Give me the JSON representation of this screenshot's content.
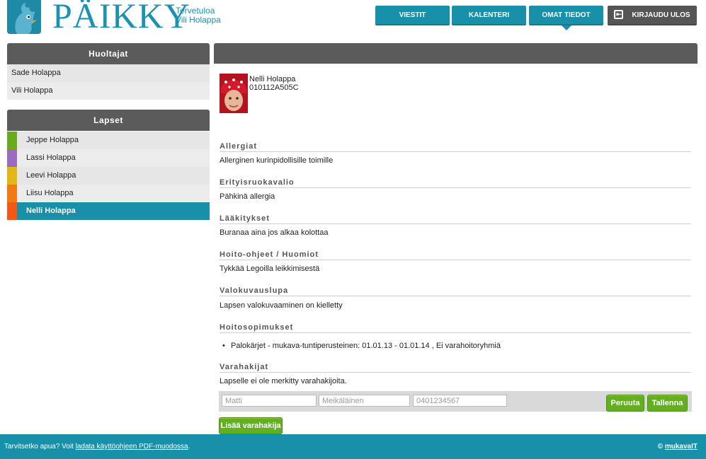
{
  "header": {
    "logo_text": "PÄIKKY",
    "welcome_line1": "Tervetuloa",
    "welcome_line2": "Vili Holappa",
    "nav": {
      "messages": "VIESTIT",
      "calendar": "KALENTERI",
      "my_info": "OMAT TIEDOT",
      "logout": "KIRJAUDU ULOS"
    }
  },
  "sidebar": {
    "guardians_title": "Huoltajat",
    "guardians": [
      "Sade Holappa",
      "Vili Holappa"
    ],
    "children_title": "Lapset",
    "children": [
      {
        "name": "Jeppe Holappa",
        "color": "#6aaa1f"
      },
      {
        "name": "Lassi Holappa",
        "color": "#9b6bc0"
      },
      {
        "name": "Leevi Holappa",
        "color": "#e0b81a"
      },
      {
        "name": "Liisu Holappa",
        "color": "#f07a14"
      },
      {
        "name": "Nelli Holappa",
        "color": "#f05a14",
        "selected": true
      }
    ]
  },
  "child": {
    "name": "Nelli Holappa",
    "id": "010112A505C"
  },
  "sections": {
    "allergies_title": "Allergiat",
    "allergies_text": "Allerginen kurinpidollisille toimille",
    "diet_title": "Erityisruokavalio",
    "diet_text": "Pähkinä allergia",
    "meds_title": "Lääkitykset",
    "meds_text": "Buranaa aina jos alkaa kolottaa",
    "care_title": "Hoito-ohjeet / Huomiot",
    "care_text": "Tykkää Legoilla leikkimisestä",
    "photo_title": "Valokuvauslupa",
    "photo_text": "Lapsen valokuvaaminen on kielletty",
    "contracts_title": "Hoitosopimukset",
    "contracts_item": "Palokärjet - mukava-tuntiperusteinen: 01.01.13 - 01.01.14 , Ei varahoitoryhmiä",
    "backup_title": "Varahakijat",
    "backup_text": "Lapselle ei ole merkitty varahakijoita."
  },
  "form": {
    "first_name_placeholder": "Matti",
    "last_name_placeholder": "Meikäläinen",
    "phone_placeholder": "0401234567",
    "cancel_label": "Peruuta",
    "save_label": "Tallenna",
    "add_label": "Lisää varahakija"
  },
  "footer": {
    "help_prefix": "Tarvitsetko apua? Voit ",
    "help_link": "ladata käyttöohjeen PDF-muodossa",
    "help_suffix": ".",
    "copyright_symbol": "©",
    "copyright_link": "mukavaIT"
  },
  "colors": {
    "primary": "#1990a9",
    "header_gray": "#5b5b5b",
    "green_button": "#62b01e"
  }
}
